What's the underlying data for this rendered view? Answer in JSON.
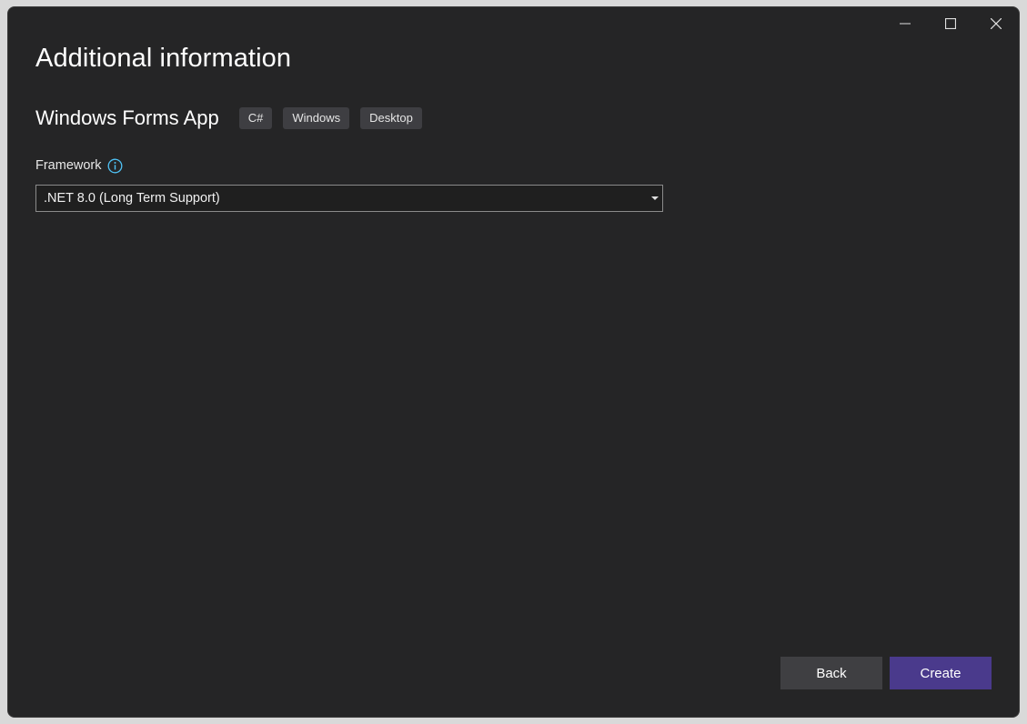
{
  "window": {
    "caption": {
      "minimize_icon": "minimize-icon",
      "maximize_icon": "maximize-icon",
      "close_icon": "close-icon"
    }
  },
  "header": {
    "title": "Additional information"
  },
  "template": {
    "name": "Windows Forms App",
    "tags": [
      "C#",
      "Windows",
      "Desktop"
    ]
  },
  "framework": {
    "label": "Framework",
    "info_icon": "info-icon",
    "selected": ".NET 8.0 (Long Term Support)"
  },
  "footer": {
    "back_label": "Back",
    "create_label": "Create"
  },
  "colors": {
    "window_bg": "#252526",
    "tag_bg": "#3e3e42",
    "primary_button": "#4a3a8c",
    "secondary_button": "#3f3f42",
    "info_accent": "#4fc3f7"
  }
}
